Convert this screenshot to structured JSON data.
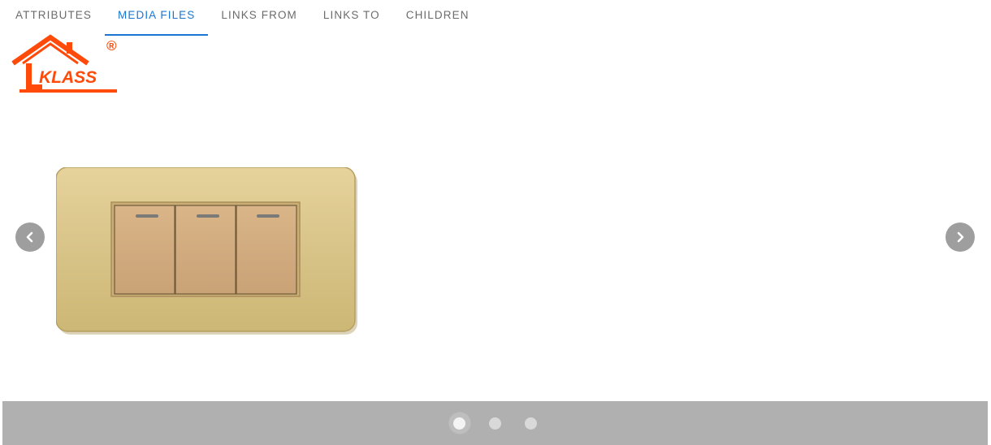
{
  "tabs": [
    {
      "label": "ATTRIBUTES",
      "active": false
    },
    {
      "label": "MEDIA FILES",
      "active": true
    },
    {
      "label": "LINKS FROM",
      "active": false
    },
    {
      "label": "LINKS TO",
      "active": false
    },
    {
      "label": "CHILDREN",
      "active": false
    }
  ],
  "logo": {
    "text": "KLASS",
    "registered_mark": "®",
    "color": "#ff4a0a"
  },
  "carousel": {
    "prev_icon": "chevron-left-icon",
    "next_icon": "chevron-right-icon",
    "slide_count": 3,
    "active_index": 0,
    "slide_image": "gold-three-gang-wall-switch"
  },
  "colors": {
    "accent": "#1976d2",
    "tab_text": "#6b6b6b",
    "indicator_bar": "#b0b0b0",
    "nav_button": "#9e9e9e"
  }
}
